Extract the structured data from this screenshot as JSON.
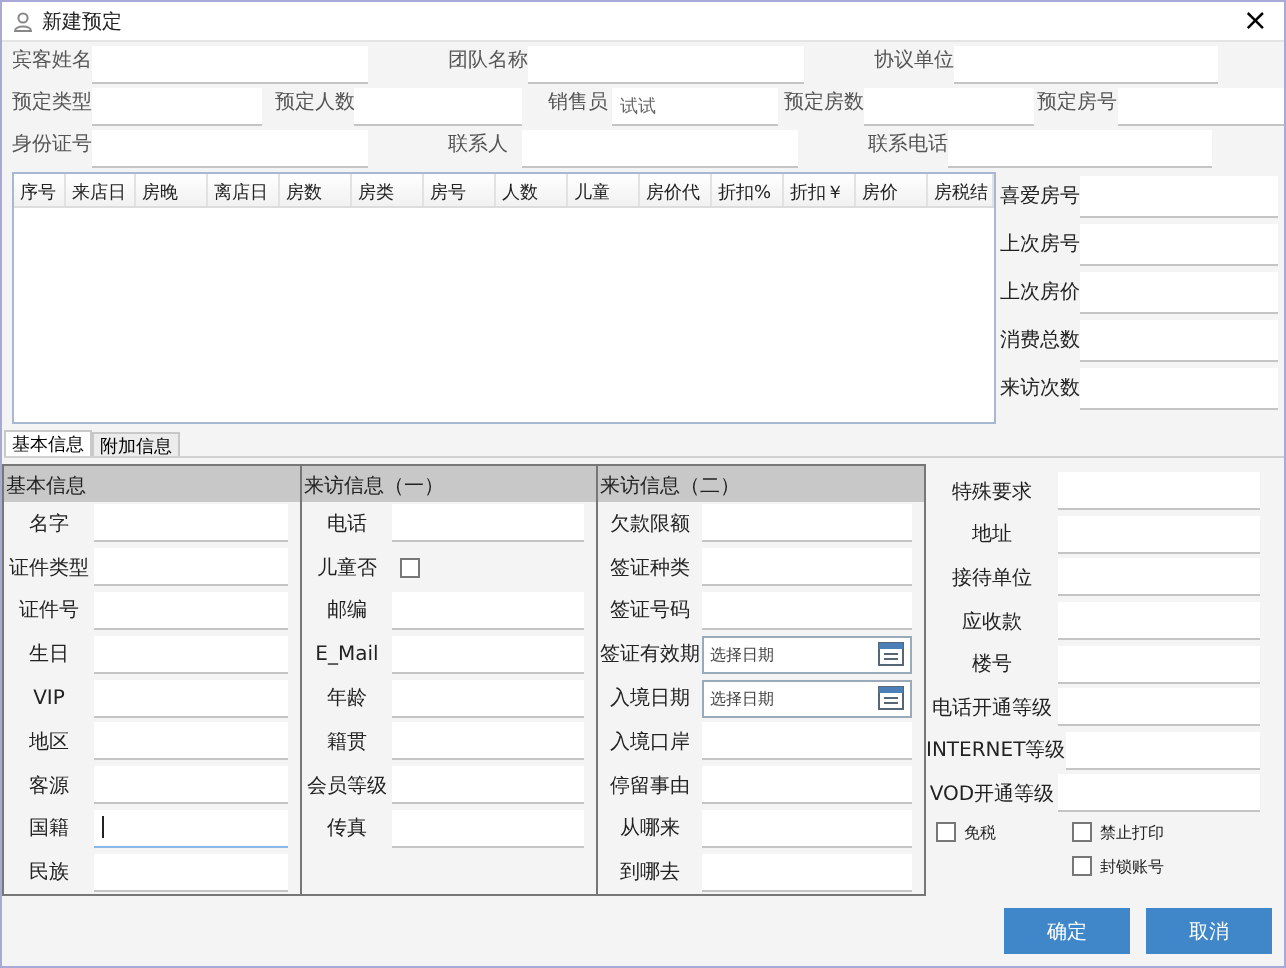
{
  "window": {
    "title": "新建预定",
    "close": "×"
  },
  "header_rows": [
    [
      {
        "label": "宾客姓名"
      },
      {
        "label": "团队名称"
      },
      {
        "label": "协议单位"
      }
    ],
    [
      {
        "label": "预定类型"
      },
      {
        "label": "预定人数"
      },
      {
        "label": "销售员",
        "value": "试试"
      },
      {
        "label": "预定房数"
      },
      {
        "label": "预定房号"
      }
    ],
    [
      {
        "label": "身份证号"
      },
      {
        "label": "联系人"
      },
      {
        "label": "联系电话"
      }
    ]
  ],
  "table": {
    "columns": [
      "序号",
      "来店日",
      "房晚",
      "离店日",
      "房数",
      "房类",
      "房号",
      "人数",
      "儿童",
      "房价代",
      "折扣%",
      "折扣￥",
      "房价",
      "房税结"
    ]
  },
  "history": [
    {
      "label": "喜爱房号"
    },
    {
      "label": "上次房号"
    },
    {
      "label": "上次房价"
    },
    {
      "label": "消费总数"
    },
    {
      "label": "来访次数"
    }
  ],
  "tabs": [
    {
      "label": "基本信息",
      "selected": true
    },
    {
      "label": "附加信息",
      "selected": false
    }
  ],
  "sections": [
    {
      "title": "基本信息",
      "fields": [
        {
          "kind": "text",
          "label": "名字",
          "focused": false
        },
        {
          "kind": "text",
          "label": "证件类型",
          "focused": false
        },
        {
          "kind": "text",
          "label": "证件号",
          "focused": false
        },
        {
          "kind": "text",
          "label": "生日",
          "focused": false
        },
        {
          "kind": "text",
          "label": "VIP",
          "focused": false
        },
        {
          "kind": "text",
          "label": "地区",
          "focused": false
        },
        {
          "kind": "text",
          "label": "客源",
          "focused": false
        },
        {
          "kind": "text",
          "label": "国籍",
          "focused": true
        },
        {
          "kind": "text",
          "label": "民族",
          "focused": false
        }
      ]
    },
    {
      "title": "来访信息（一）",
      "fields": [
        {
          "kind": "text",
          "label": "电话",
          "focused": false
        },
        {
          "kind": "checkbox",
          "label": "儿童否",
          "checked": false
        },
        {
          "kind": "text",
          "label": "邮编",
          "focused": false
        },
        {
          "kind": "text",
          "label": "E_Mail",
          "focused": false
        },
        {
          "kind": "text",
          "label": "年龄",
          "focused": false
        },
        {
          "kind": "text",
          "label": "籍贯",
          "focused": false
        },
        {
          "kind": "text",
          "label": "会员等级",
          "focused": false
        },
        {
          "kind": "text",
          "label": "传真",
          "focused": false
        }
      ]
    },
    {
      "title": "来访信息（二）",
      "fields": [
        {
          "kind": "text",
          "label": "欠款限额",
          "focused": false
        },
        {
          "kind": "text",
          "label": "签证种类",
          "focused": false
        },
        {
          "kind": "text",
          "label": "签证号码",
          "focused": false
        },
        {
          "kind": "date",
          "label": "签证有效期",
          "placeholder": "选择日期"
        },
        {
          "kind": "date",
          "label": "入境日期",
          "placeholder": "选择日期"
        },
        {
          "kind": "text",
          "label": "入境口岸",
          "focused": false
        },
        {
          "kind": "text",
          "label": "停留事由",
          "focused": false
        },
        {
          "kind": "text",
          "label": "从哪来",
          "focused": false
        },
        {
          "kind": "text",
          "label": "到哪去",
          "focused": false
        }
      ]
    }
  ],
  "extra_fields": [
    {
      "label": "特殊要求"
    },
    {
      "label": "地址"
    },
    {
      "label": "接待单位"
    },
    {
      "label": "应收款"
    },
    {
      "label": "楼号"
    },
    {
      "label": "电话开通等级"
    },
    {
      "label": "INTERNET等级"
    },
    {
      "label": "VOD开通等级"
    }
  ],
  "flags": [
    {
      "label": "免税",
      "checked": false
    },
    {
      "label": "禁止打印",
      "checked": false
    },
    {
      "label": "封锁账号",
      "checked": false
    }
  ],
  "buttons": [
    "确定",
    "取消"
  ]
}
